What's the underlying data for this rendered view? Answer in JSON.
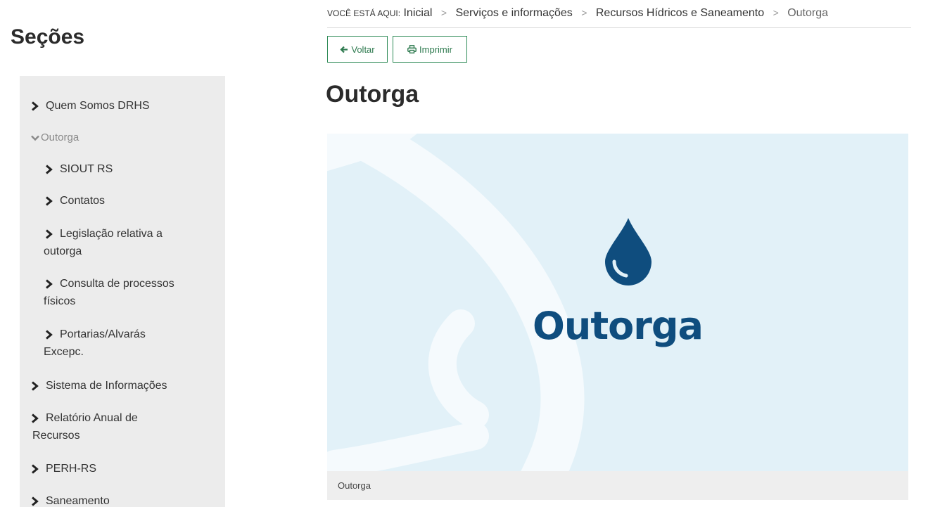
{
  "sidebar": {
    "title": "Seções",
    "items": [
      {
        "label": "Quem Somos DRHS"
      },
      {
        "label": "Outorga"
      },
      {
        "label": "SIOUT RS"
      },
      {
        "label": "Contatos"
      },
      {
        "label": "Legislação relativa a",
        "label_cont": "outorga"
      },
      {
        "label": "Consulta de processos",
        "label_cont": "físicos"
      },
      {
        "label": "Portarias/Alvarás",
        "label_cont": "Excepc."
      },
      {
        "label": "Sistema de Informações"
      },
      {
        "label": "Relatório Anual de",
        "label_cont": "Recursos"
      },
      {
        "label": "PERH-RS"
      },
      {
        "label": "Saneamento"
      }
    ]
  },
  "breadcrumb": {
    "prefix": "VOCÊ ESTÁ AQUI:",
    "items": [
      "Inicial",
      "Serviços e informações",
      "Recursos Hídricos e Saneamento",
      "Outorga"
    ],
    "separator": ">"
  },
  "toolbar": {
    "back_label": "Voltar",
    "print_label": "Imprimir",
    "accent_color": "#2e8b57"
  },
  "main": {
    "title": "Outorga",
    "banner_text": "Outorga",
    "banner_bg": "#e2f1f8",
    "banner_brand_color": "#0f4d7e",
    "caption": "Outorga"
  },
  "icons": {
    "back": "arrow-left-icon",
    "print": "printer-icon",
    "nav": "chevron-right-icon",
    "nav_expanded": "chevron-down-icon",
    "banner": "water-drop-icon"
  }
}
